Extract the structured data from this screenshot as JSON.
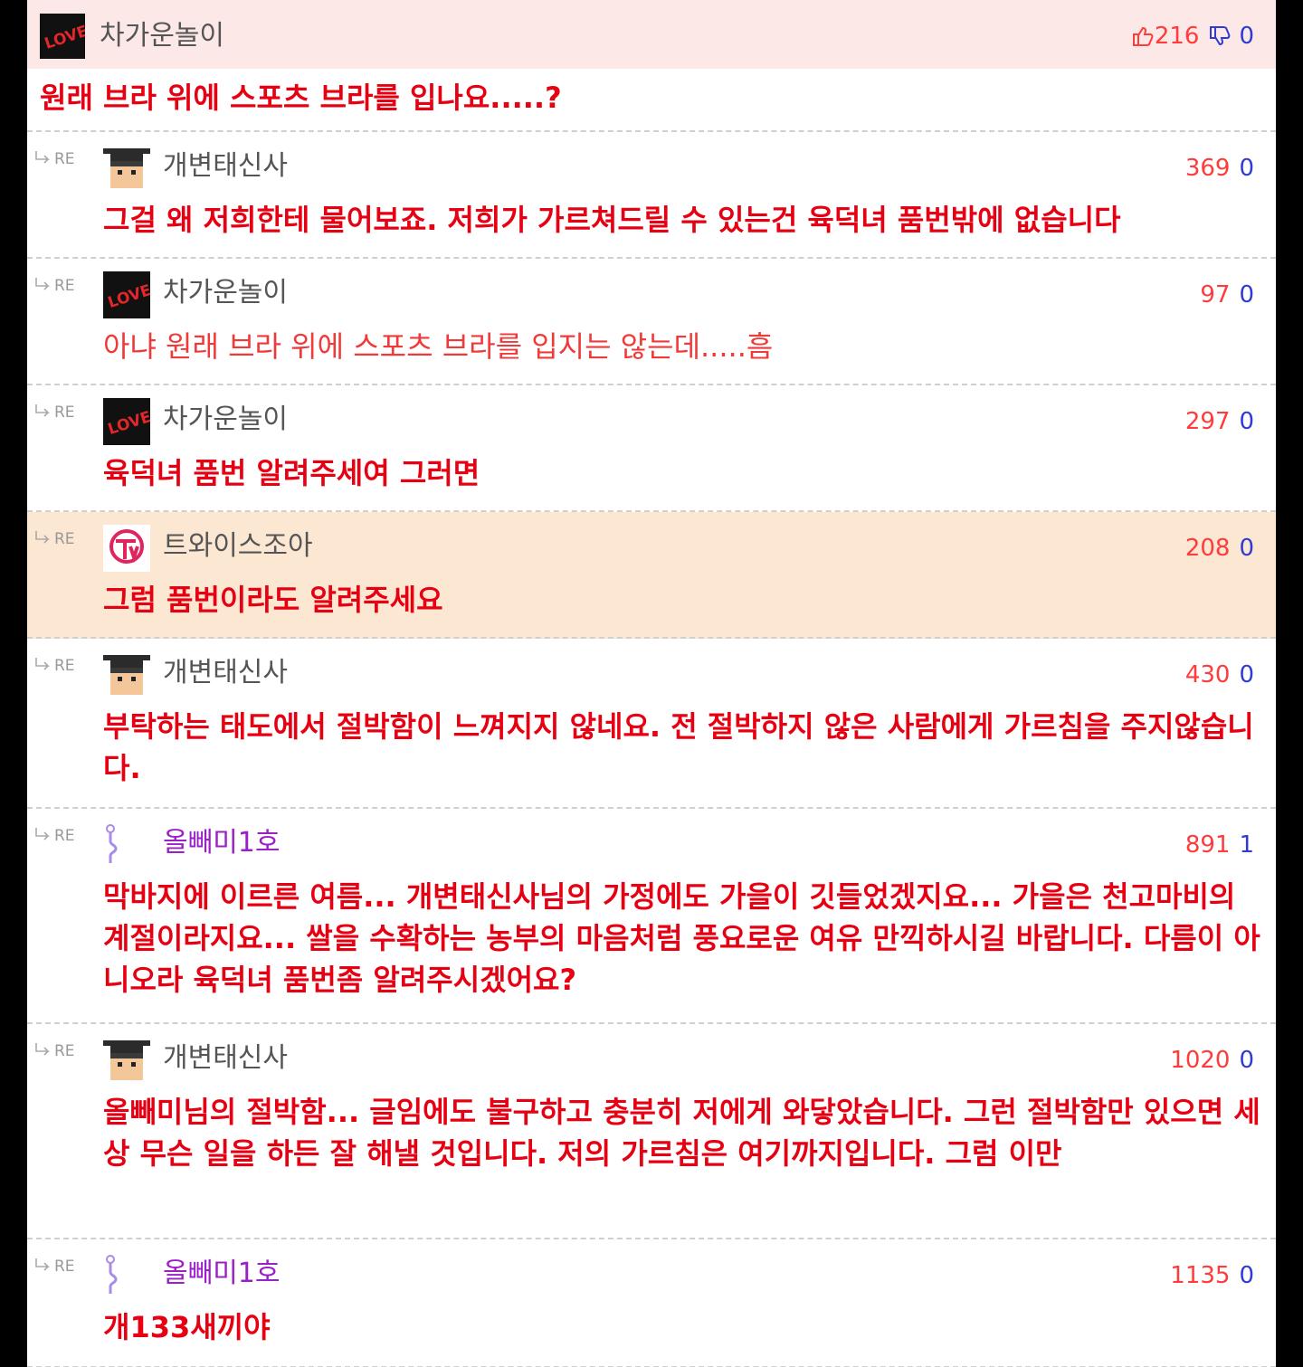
{
  "post": {
    "author": "차가운놀이",
    "likes": "216",
    "dislikes": "0",
    "title": "원래 브라 위에 스포츠 브라를 입나요.....?"
  },
  "re_label": "RE",
  "comments": [
    {
      "author": "개변태신사",
      "likes": "369",
      "dislikes": "0",
      "text": "그걸 왜 저희한테 물어보죠. 저희가 가르쳐드릴 수 있는건 육덕녀 품번밖에 없습니다"
    },
    {
      "author": "차가운놀이",
      "likes": "97",
      "dislikes": "0",
      "text": "아냐 원래 브라 위에 스포츠 브라를 입지는 않는데.....흠"
    },
    {
      "author": "차가운놀이",
      "likes": "297",
      "dislikes": "0",
      "text": "육덕녀 품번 알려주세여 그러면"
    },
    {
      "author": "트와이스조아",
      "likes": "208",
      "dislikes": "0",
      "text": "그럼 품번이라도 알려주세요"
    },
    {
      "author": "개변태신사",
      "likes": "430",
      "dislikes": "0",
      "text": "부탁하는 태도에서 절박함이 느껴지지 않네요. 전 절박하지 않은 사람에게 가르침을 주지않습니다."
    },
    {
      "author": "올빼미1호",
      "likes": "891",
      "dislikes": "1",
      "text": "막바지에 이르른 여름... 개변태신사님의 가정에도 가을이 깃들었겠지요... 가을은 천고마비의 계절이라지요... 쌀을 수확하는 농부의 마음처럼 풍요로운 여유 만끽하시길 바랍니다. 다름이 아니오라 육덕녀 품번좀 알려주시겠어요?"
    },
    {
      "author": "개변태신사",
      "likes": "1020",
      "dislikes": "0",
      "text": "올빼미님의 절박함... 글임에도 불구하고 충분히 저에게 와닿았습니다. 그런 절박함만 있으면 세상 무슨 일을 하든 잘 해낼 것입니다. 저의 가르침은 여기까지입니다. 그럼 이만"
    },
    {
      "author": "올빼미1호",
      "likes": "1135",
      "dislikes": "0",
      "text": "개133새끼야"
    }
  ]
}
